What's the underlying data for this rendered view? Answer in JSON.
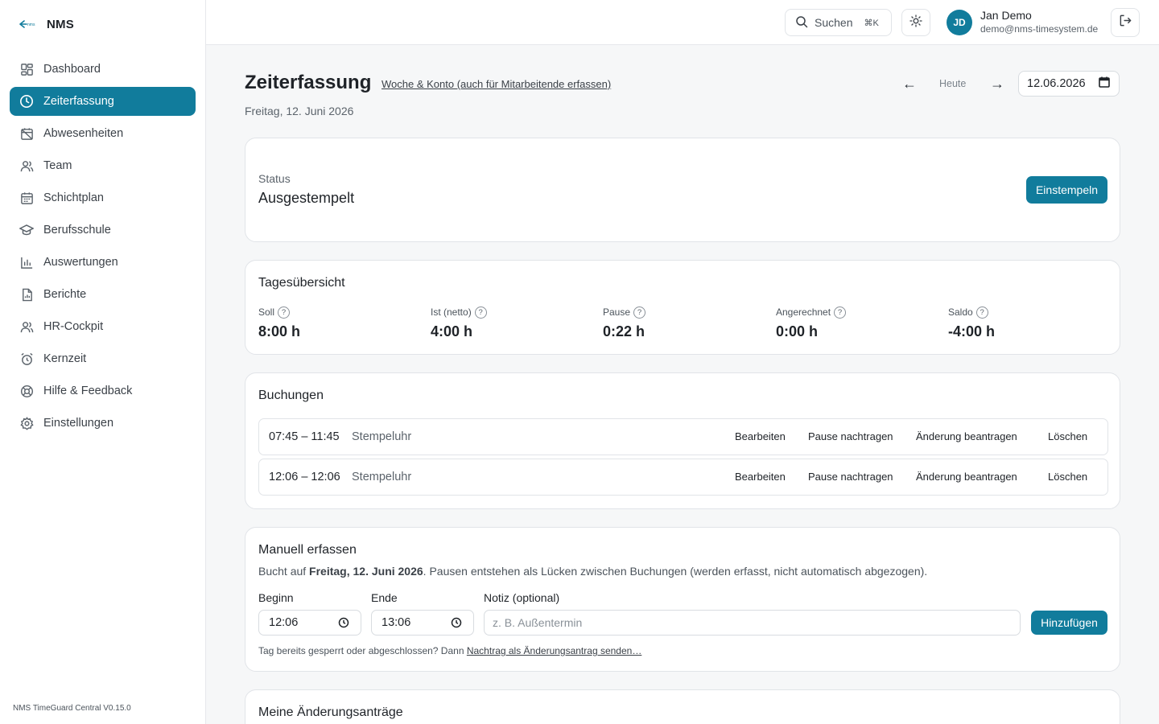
{
  "app": {
    "name": "NMS",
    "version": "NMS TimeGuard Central V0.15.0"
  },
  "sidebar": {
    "items": [
      {
        "label": "Dashboard",
        "icon": "dashboard-icon",
        "active": false
      },
      {
        "label": "Zeiterfassung",
        "icon": "clock-icon",
        "active": true
      },
      {
        "label": "Abwesenheiten",
        "icon": "calendar-off-icon",
        "active": false
      },
      {
        "label": "Team",
        "icon": "users-icon",
        "active": false
      },
      {
        "label": "Schichtplan",
        "icon": "calendar-icon",
        "active": false
      },
      {
        "label": "Berufsschule",
        "icon": "graduation-cap-icon",
        "active": false
      },
      {
        "label": "Auswertungen",
        "icon": "bar-chart-icon",
        "active": false
      },
      {
        "label": "Berichte",
        "icon": "file-chart-icon",
        "active": false
      },
      {
        "label": "HR-Cockpit",
        "icon": "user-group-icon",
        "active": false
      },
      {
        "label": "Kernzeit",
        "icon": "alarm-clock-icon",
        "active": false
      },
      {
        "label": "Hilfe & Feedback",
        "icon": "lifebuoy-icon",
        "active": false
      },
      {
        "label": "Einstellungen",
        "icon": "gear-icon",
        "active": false
      }
    ]
  },
  "topbar": {
    "search_label": "Suchen",
    "search_shortcut": "⌘K",
    "user_initials": "JD",
    "user_name": "Jan Demo",
    "user_email": "demo@nms-timesystem.de"
  },
  "header": {
    "title": "Zeiterfassung",
    "link": "Woche & Konto (auch für Mitarbeitende erfassen)",
    "date_long": "Freitag, 12. Juni 2026",
    "prev_arrow": "←",
    "today_label": "Heute",
    "next_arrow": "→",
    "date_value": "12.06.2026"
  },
  "status_card": {
    "label": "Status",
    "value": "Ausgestempelt",
    "button": "Einstempeln"
  },
  "overview": {
    "title": "Tagesübersicht",
    "stats": [
      {
        "label": "Soll",
        "value": "8:00 h"
      },
      {
        "label": "Ist (netto)",
        "value": "4:00 h"
      },
      {
        "label": "Pause",
        "value": "0:22 h"
      },
      {
        "label": "Angerechnet",
        "value": "0:00 h"
      },
      {
        "label": "Saldo",
        "value": "-4:00 h"
      }
    ],
    "help_glyph": "?"
  },
  "bookings": {
    "title": "Buchungen",
    "actions": {
      "edit": "Bearbeiten",
      "add_break": "Pause nachtragen",
      "request_change": "Änderung beantragen",
      "delete": "Löschen"
    },
    "rows": [
      {
        "time": "07:45 – 11:45",
        "source": "Stempeluhr"
      },
      {
        "time": "12:06 – 12:06",
        "source": "Stempeluhr"
      }
    ]
  },
  "manual": {
    "title": "Manuell erfassen",
    "desc_prefix": "Bucht auf",
    "desc_date": "Freitag, 12. Juni 2026",
    "desc_suffix": ". Pausen entstehen als Lücken zwischen Buchungen (werden erfasst, nicht automatisch abgezogen).",
    "begin_label": "Beginn",
    "begin_value": "12:06",
    "end_label": "Ende",
    "end_value": "13:06",
    "note_label": "Notiz (optional)",
    "note_placeholder": "z. B. Außentermin",
    "add_button": "Hinzufügen",
    "footnote_prefix": "Tag bereits gesperrt oder abgeschlossen? Dann",
    "footnote_link": "Nachtrag als Änderungsantrag senden…"
  },
  "requests": {
    "title": "Meine Änderungsanträge"
  },
  "colors": {
    "accent": "#117c9c",
    "background": "#f6f7f8",
    "border": "#e1e4e8"
  }
}
